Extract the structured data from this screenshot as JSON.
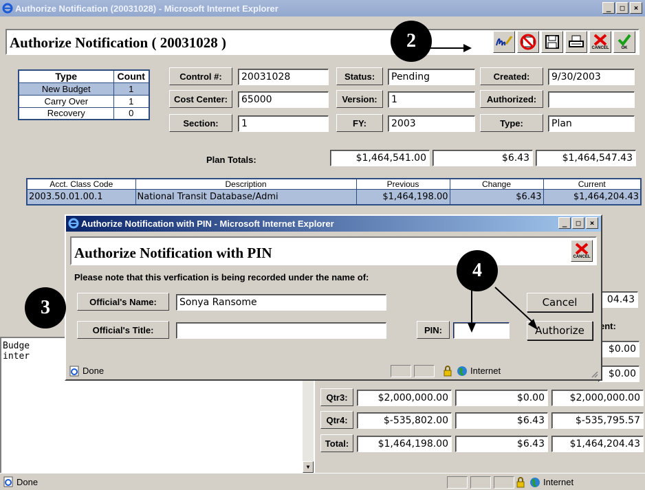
{
  "main_window": {
    "title": "Authorize Notification (20031028) - Microsoft Internet Explorer",
    "page_title": "Authorize Notification ( 20031028 )",
    "toolbar": {
      "cancel_label": "CANCEL",
      "ok_label": "OK"
    },
    "type_table": {
      "headers": [
        "Type",
        "Count"
      ],
      "rows": [
        {
          "type": "New Budget",
          "count": "1"
        },
        {
          "type": "Carry Over",
          "count": "1"
        },
        {
          "type": "Recovery",
          "count": "0"
        }
      ]
    },
    "fields": {
      "control_label": "Control #:",
      "control_value": "20031028",
      "status_label": "Status:",
      "status_value": "Pending",
      "created_label": "Created:",
      "created_value": "9/30/2003",
      "cost_center_label": "Cost Center:",
      "cost_center_value": "65000",
      "version_label": "Version:",
      "version_value": "1",
      "authorized_label": "Authorized:",
      "authorized_value": "",
      "section_label": "Section:",
      "section_value": "1",
      "fy_label": "FY:",
      "fy_value": "2003",
      "type_label": "Type:",
      "type_value": "Plan"
    },
    "plan_totals": {
      "label": "Plan Totals:",
      "previous": "$1,464,541.00",
      "change": "$6.43",
      "current": "$1,464,547.43"
    },
    "account_table": {
      "headers": [
        "Acct. Class Code",
        "Description",
        "Previous",
        "Change",
        "Current"
      ],
      "rows": [
        {
          "code": "2003.50.01.00.1",
          "description": "National Transit Database/Admi",
          "previous": "$1,464,198.00",
          "change": "$6.43",
          "current": "$1,464,204.43"
        }
      ]
    },
    "partial": {
      "right_total": "04.43",
      "ent_header": "ent:",
      "q1_current": "$0.00",
      "q2_current": "$0.00"
    },
    "notes_text_line1": "Budge",
    "notes_text_line2": "inter",
    "quarters": [
      {
        "label": "Qtr3:",
        "previous": "$2,000,000.00",
        "change": "$0.00",
        "current": "$2,000,000.00"
      },
      {
        "label": "Qtr4:",
        "previous": "$-535,802.00",
        "change": "$6.43",
        "current": "$-535,795.57"
      },
      {
        "label": "Total:",
        "previous": "$1,464,198.00",
        "change": "$6.43",
        "current": "$1,464,204.43"
      }
    ],
    "status_done": "Done",
    "status_zone": "Internet"
  },
  "dialog": {
    "title": "Authorize Notification with PIN - Microsoft Internet Explorer",
    "heading": "Authorize Notification with PIN",
    "cancel_icon_label": "CANCEL",
    "note": "Please note that this verfication is being recorded under the name of:",
    "officials_name_label": "Official's Name:",
    "officials_name_value": "Sonya Ransome",
    "officials_title_label": "Official's Title:",
    "officials_title_value": "",
    "pin_label": "PIN:",
    "pin_value": "",
    "cancel_button": "Cancel",
    "authorize_button": "Authorize",
    "status_done": "Done",
    "status_zone": "Internet"
  },
  "callouts": {
    "c2": "2",
    "c3": "3",
    "c4": "4"
  }
}
